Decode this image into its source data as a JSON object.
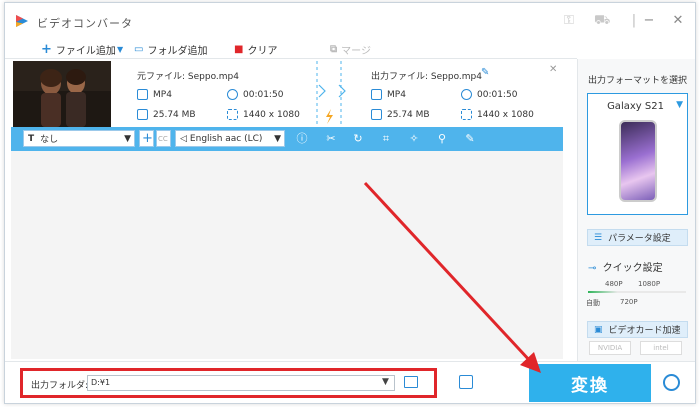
{
  "window": {
    "title": "ビデオコンバータ"
  },
  "toolbar": {
    "add_file": "ファイル追加",
    "add_folder": "フォルダ追加",
    "clear": "クリア",
    "merge": "マージ"
  },
  "file": {
    "source_label": "元ファイル: Seppo.mp4",
    "source_format": "MP4",
    "source_duration": "00:01:50",
    "source_size": "25.74 MB",
    "source_resolution": "1440 x 1080",
    "output_label": "出力ファイル: Seppo.mp4",
    "output_format": "MP4",
    "output_duration": "00:01:50",
    "output_size": "25.74 MB",
    "output_resolution": "1440 x 1080"
  },
  "controls": {
    "subtitle_value": "なし",
    "audio_track": "English aac (LC)"
  },
  "right_panel": {
    "title": "出力フォーマットを選択",
    "device": "Galaxy S21",
    "param_button": "パラメータ設定",
    "quick_settings": "クイック設定",
    "quality_marks": [
      "480P",
      "1080P",
      "自動",
      "720P"
    ],
    "gpu_accel": "ビデオカード加速",
    "gpu_chips": [
      "NVIDIA",
      "intel"
    ]
  },
  "bottom": {
    "output_folder_label": "出力フォルダ:",
    "output_folder_value": "D:¥1",
    "convert_button": "変換"
  },
  "colors": {
    "accent": "#2fb1ec",
    "strip": "#4fb4ec",
    "annotation_red": "#e0262a",
    "orange": "#f5a623"
  }
}
